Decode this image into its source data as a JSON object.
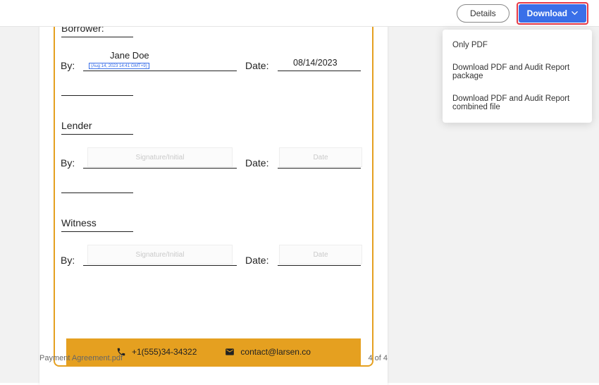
{
  "topbar": {
    "details_label": "Details",
    "download_label": "Download"
  },
  "dropdown": {
    "items": [
      "Only PDF",
      "Download PDF and Audit Report package",
      "Download PDF and Audit Report combined file"
    ]
  },
  "document": {
    "borrower_label": "Borrower:",
    "lender_label": "Lender",
    "witness_label": "Witness",
    "by_label": "By:",
    "date_label": "Date:",
    "borrower_name": "Jane Doe",
    "borrower_sig_tag": "(Aug 14, 2023 14:41 GMT+9)",
    "borrower_date": "08/14/2023",
    "sig_placeholder": "Signature/Initial",
    "date_placeholder": "Date"
  },
  "footer": {
    "phone": "+1(555)34-34322",
    "email": "contact@larsen.co"
  },
  "statusbar": {
    "filename": "Payment Agreement.pdf",
    "page": "4 of 4"
  }
}
